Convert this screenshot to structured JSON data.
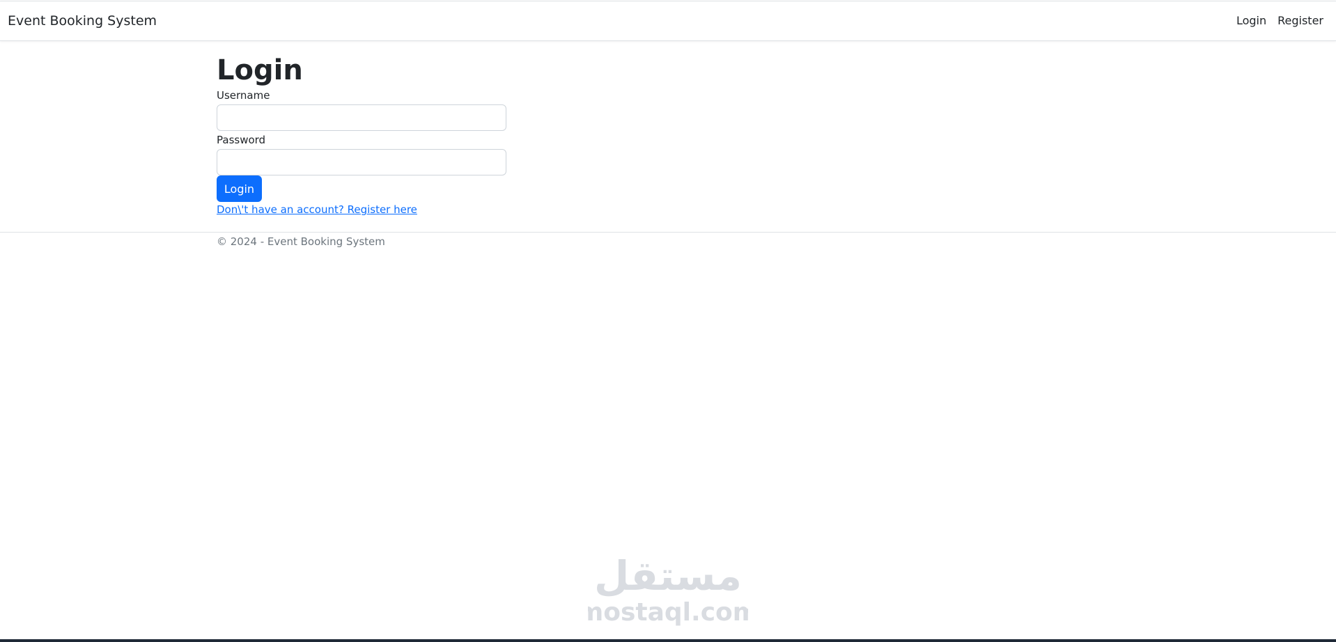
{
  "header": {
    "brand": "Event Booking System",
    "links": [
      {
        "label": "Login"
      },
      {
        "label": "Register"
      }
    ]
  },
  "login": {
    "title": "Login",
    "username_label": "Username",
    "username_value": "",
    "password_label": "Password",
    "password_value": "",
    "submit_label": "Login",
    "register_link": "Don\\'t have an account? Register here"
  },
  "footer": {
    "text": "© 2024 - Event Booking System"
  },
  "watermark": {
    "arabic": "مستقل",
    "latin": "mostaql.com",
    "color": "#d9dce1"
  },
  "colors": {
    "primary": "#0d6efd",
    "text": "#212529",
    "muted": "#6c757d",
    "border": "#dee2e6"
  }
}
